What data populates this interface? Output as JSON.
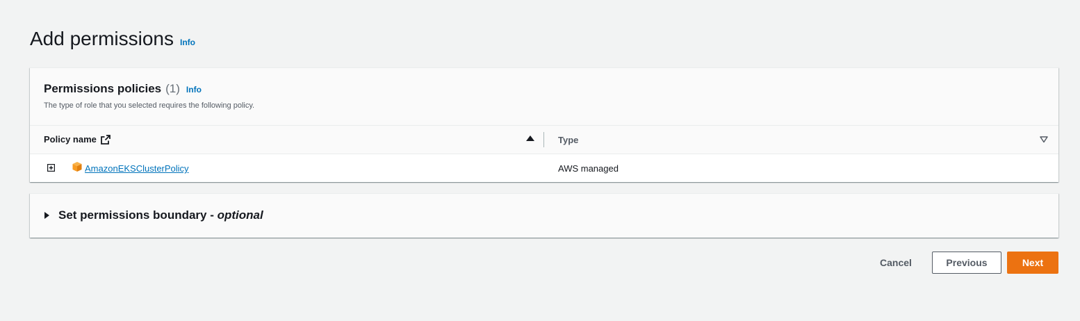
{
  "page": {
    "title": "Add permissions",
    "info_label": "Info"
  },
  "policies_panel": {
    "title": "Permissions policies",
    "count": "(1)",
    "info_label": "Info",
    "description": "The type of role that you selected requires the following policy.",
    "columns": {
      "policy_name": "Policy name",
      "type": "Type"
    },
    "rows": [
      {
        "policy_name": "AmazonEKSClusterPolicy",
        "type": "AWS managed"
      }
    ]
  },
  "boundary_panel": {
    "title": "Set permissions boundary - ",
    "optional": "optional"
  },
  "actions": {
    "cancel": "Cancel",
    "previous": "Previous",
    "next": "Next"
  },
  "colors": {
    "accent": "#0073bb",
    "primary_button": "#ec7211",
    "aws_icon": "#f89c24"
  },
  "icons": {
    "external_link": "external-link-icon",
    "expand": "expand-plus-icon",
    "policy": "aws-managed-policy-icon",
    "sort_ascending": "sort-ascending-icon",
    "sort_none": "sort-descending-icon",
    "caret": "caret-right-icon"
  }
}
